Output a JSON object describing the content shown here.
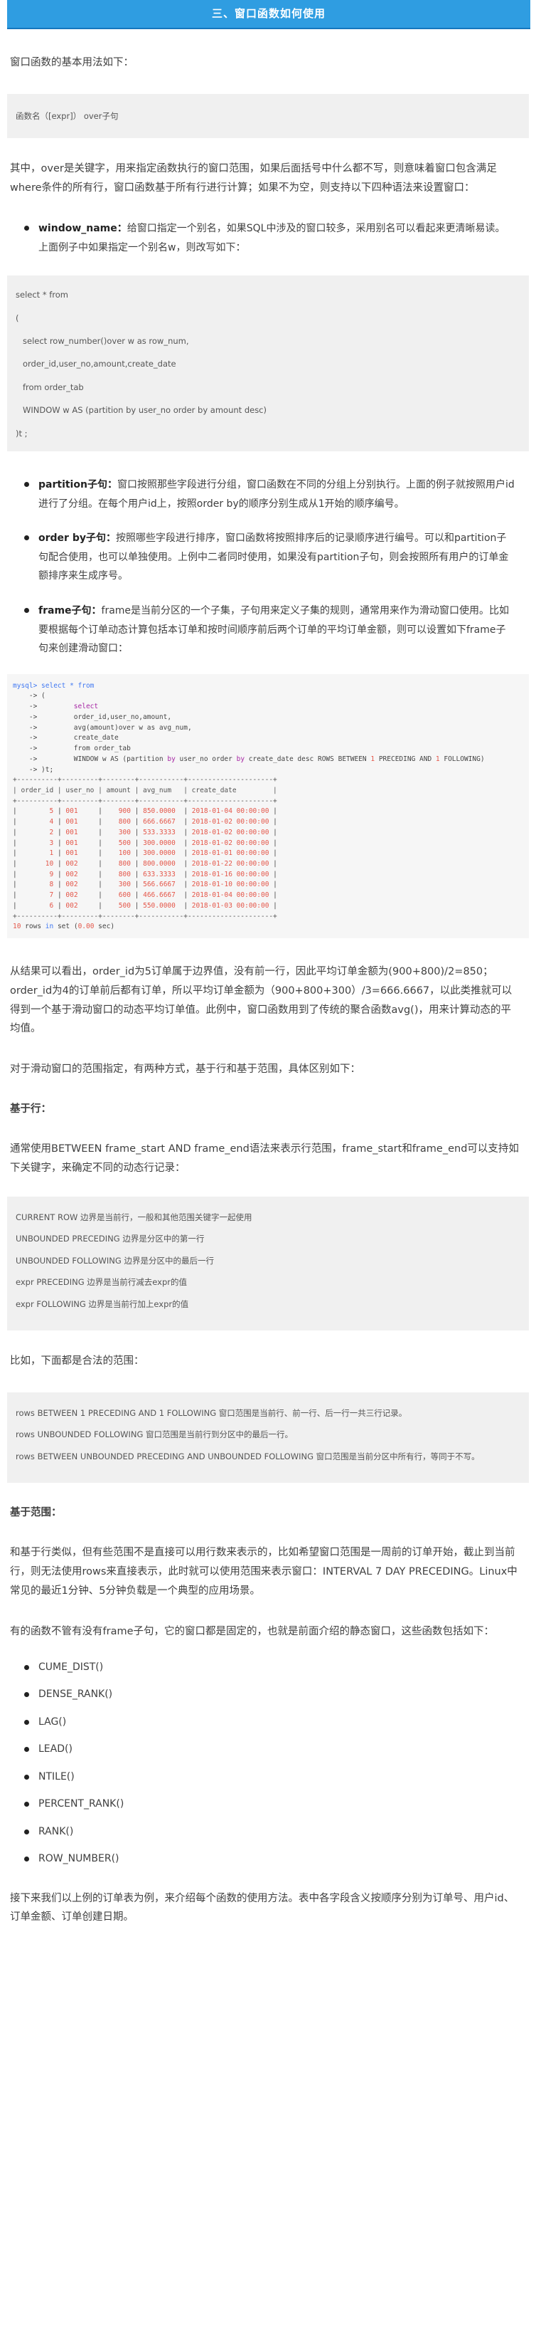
{
  "title": "三、窗口函数如何使用",
  "p1": "窗口函数的基本用法如下：",
  "syntax_code": "函数名（[expr]） over子句",
  "p2": "其中，over是关键字，用来指定函数执行的窗口范围，如果后面括号中什么都不写，则意味着窗口包含满足where条件的所有行，窗口函数基于所有行进行计算；如果不为空，则支持以下四种语法来设置窗口：",
  "bullet_window": {
    "term": "window_name：",
    "text": "给窗口指定一个别名，如果SQL中涉及的窗口较多，采用别名可以看起来更清晰易读。上面例子中如果指定一个别名w，则改写如下："
  },
  "window_code": [
    "select * from",
    "(",
    "   select row_number()over w as row_num,",
    "   order_id,user_no,amount,create_date",
    "   from order_tab",
    "   WINDOW w AS (partition by user_no order by amount desc)",
    ")t ;"
  ],
  "bullet_partition": {
    "term": "partition子句：",
    "text": "窗口按照那些字段进行分组，窗口函数在不同的分组上分别执行。上面的例子就按照用户id进行了分组。在每个用户id上，按照order by的顺序分别生成从1开始的顺序编号。"
  },
  "bullet_order": {
    "term": "order by子句：",
    "text": "按照哪些字段进行排序，窗口函数将按照排序后的记录顺序进行编号。可以和partition子句配合使用，也可以单独使用。上例中二者同时使用，如果没有partition子句，则会按照所有用户的订单金额排序来生成序号。"
  },
  "bullet_frame": {
    "term": "frame子句：",
    "text": "frame是当前分区的一个子集，子句用来定义子集的规则，通常用来作为滑动窗口使用。比如要根据每个订单动态计算包括本订单和按时间顺序前后两个订单的平均订单金额，则可以设置如下frame子句来创建滑动窗口："
  },
  "terminal": {
    "q1": "mysql> ",
    "q1_kw": "select * from",
    "q2": "    -> (",
    "q3_arrow": "    ->         ",
    "q3_kw": "select",
    "q4": "    ->         order_id,user_no,amount,",
    "q5": "    ->         avg(amount)over w as avg_num,",
    "q6": "    ->         create_date",
    "q7": "    ->         from order_tab",
    "q8_a": "    ->         WINDOW w AS (partition ",
    "q8_b": "by",
    "q8_c": " user_no order ",
    "q8_d": "by",
    "q8_e": " create_date desc ROWS BETWEEN ",
    "q8_f": "1",
    "q8_g": " PRECEDING AND ",
    "q8_h": "1",
    "q8_i": " FOLLOWING)",
    "q9": "    -> )t;",
    "border": "+----------+---------+--------+-----------+---------------------+",
    "header": "| order_id | user_no | amount | avg_num   | create_date         |",
    "rows": [
      [
        "5",
        "001",
        "900",
        "850.0000",
        "2018-01-04 00:00:00"
      ],
      [
        "4",
        "001",
        "800",
        "666.6667",
        "2018-01-02 00:00:00"
      ],
      [
        "2",
        "001",
        "300",
        "533.3333",
        "2018-01-02 00:00:00"
      ],
      [
        "3",
        "001",
        "500",
        "300.0000",
        "2018-01-02 00:00:00"
      ],
      [
        "1",
        "001",
        "100",
        "300.0000",
        "2018-01-01 00:00:00"
      ],
      [
        "10",
        "002",
        "800",
        "800.0000",
        "2018-01-22 00:00:00"
      ],
      [
        "9",
        "002",
        "800",
        "633.3333",
        "2018-01-16 00:00:00"
      ],
      [
        "8",
        "002",
        "300",
        "566.6667",
        "2018-01-10 00:00:00"
      ],
      [
        "7",
        "002",
        "600",
        "466.6667",
        "2018-01-04 00:00:00"
      ],
      [
        "6",
        "002",
        "500",
        "550.0000",
        "2018-01-03 00:00:00"
      ]
    ],
    "footer_count": "10",
    "footer_rest": " rows ",
    "footer_in": "in",
    "footer_set": " set (",
    "footer_time": "0.00",
    "footer_end": " sec)"
  },
  "p3": "从结果可以看出，order_id为5订单属于边界值，没有前一行，因此平均订单金额为(900+800)/2=850；order_id为4的订单前后都有订单，所以平均订单金额为（900+800+300）/3=666.6667，以此类推就可以得到一个基于滑动窗口的动态平均订单值。此例中，窗口函数用到了传统的聚合函数avg()，用来计算动态的平均值。",
  "p4": "对于滑动窗口的范围指定，有两种方式，基于行和基于范围，具体区别如下：",
  "h_rows": "基于行：",
  "p5": "通常使用BETWEEN frame_start AND frame_end语法来表示行范围，frame_start和frame_end可以支持如下关键字，来确定不同的动态行记录：",
  "rows_keywords": [
    "CURRENT ROW 边界是当前行，一般和其他范围关键字一起使用",
    "UNBOUNDED PRECEDING 边界是分区中的第一行",
    "UNBOUNDED FOLLOWING 边界是分区中的最后一行",
    "expr PRECEDING  边界是当前行减去expr的值",
    "expr FOLLOWING  边界是当前行加上expr的值"
  ],
  "p6": "比如，下面都是合法的范围：",
  "legal_ranges": [
    "rows BETWEEN 1 PRECEDING AND 1 FOLLOWING 窗口范围是当前行、前一行、后一行一共三行记录。",
    "rows  UNBOUNDED FOLLOWING 窗口范围是当前行到分区中的最后一行。",
    "rows BETWEEN UNBOUNDED PRECEDING AND UNBOUNDED FOLLOWING 窗口范围是当前分区中所有行，等同于不写。"
  ],
  "h_range": "基于范围：",
  "p7": "和基于行类似，但有些范围不是直接可以用行数来表示的，比如希望窗口范围是一周前的订单开始，截止到当前行，则无法使用rows来直接表示，此时就可以使用范围来表示窗口：INTERVAL 7 DAY PRECEDING。Linux中常见的最近1分钟、5分钟负载是一个典型的应用场景。",
  "p8": "有的函数不管有没有frame子句，它的窗口都是固定的，也就是前面介绍的静态窗口，这些函数包括如下：",
  "functions": [
    "CUME_DIST()",
    "DENSE_RANK()",
    "LAG()",
    "LEAD()",
    "NTILE()",
    "PERCENT_RANK()",
    "RANK()",
    "ROW_NUMBER()"
  ],
  "p9": "接下来我们以上例的订单表为例，来介绍每个函数的使用方法。表中各字段含义按顺序分别为订单号、用户id、订单金额、订单创建日期。"
}
